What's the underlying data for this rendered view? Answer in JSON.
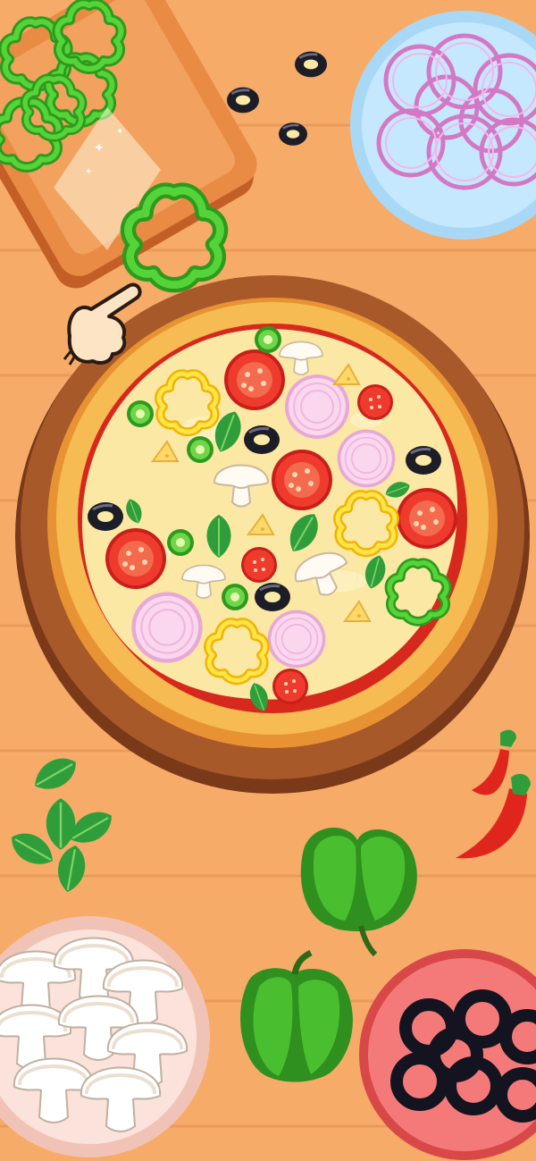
{
  "game": {
    "screen": "pizza-topping-stage",
    "hint": "drag-to-pizza",
    "colors": {
      "table": "#f6ab68",
      "plank_line": "#e8955a",
      "board": "#cf6a2f",
      "crust": "#f4b54a",
      "sauce": "#e23a2a",
      "cheese": "#fbe9a7",
      "green_pepper": "#3fbf2c",
      "yellow_pepper": "#ffd21f",
      "onion": "#f5c6e6",
      "tomato": "#e83228",
      "olive": "#1f1f2a",
      "mushroom": "#f7f2ea",
      "plate_blue": "#bfe6ff",
      "plate_pink": "#f8d8d1",
      "plate_red": "#f36e6e"
    },
    "icons": [
      "cutting-board",
      "green-pepper-ring",
      "olive",
      "onion-rings",
      "pizza",
      "hand-pointer",
      "basil-leaf",
      "chili-pepper",
      "bell-pepper",
      "mushroom-slice",
      "olive-rings"
    ]
  }
}
